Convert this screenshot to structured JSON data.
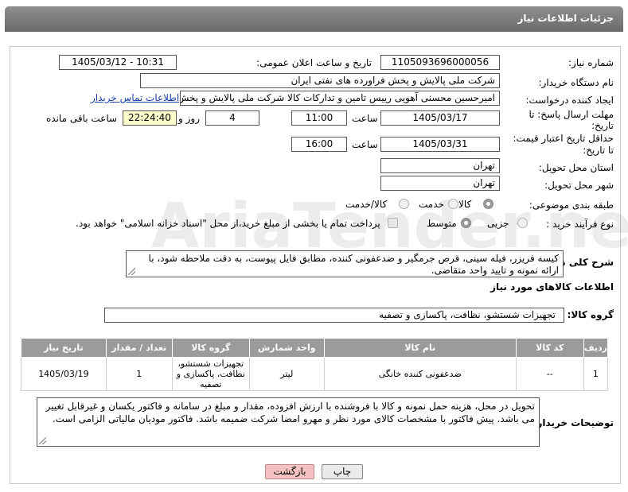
{
  "window": {
    "title": "جزئیات اطلاعات نیاز"
  },
  "watermark": "AriaTender.net",
  "form": {
    "need_number": {
      "label": "شماره نیاز:",
      "value": "1105093696000056"
    },
    "announce_datetime": {
      "label": "تاریخ و ساعت اعلان عمومی:",
      "value": "1405/03/12 - 10:31"
    },
    "buyer_org": {
      "label": "نام دستگاه خریدار:",
      "value": "شرکت ملی پالایش و پخش فراورده های نفتی ایران"
    },
    "requester": {
      "label": "ایجاد کننده درخواست:",
      "value": "امیرحسین محسنی آهویی رییس تامین و تدارکات کالا شرکت ملی پالایش و پخش",
      "contact_link": "اطلاعات تماس خریدار"
    },
    "reply_deadline": {
      "label_line1": "مهلت ارسال پاسخ: تا",
      "label_line2": "تاریخ:",
      "date": "1405/03/17",
      "time_label": "ساعت",
      "time": "11:00",
      "days": "4",
      "days_label": "روز و",
      "remaining": "22:24:40",
      "remaining_label": "ساعت باقی مانده"
    },
    "price_validity": {
      "label_line1": "حداقل تاریخ اعتبار قیمت:",
      "label_line2": "تا تاریخ:",
      "date": "1405/03/31",
      "time_label": "ساعت",
      "time": "16:00"
    },
    "province": {
      "label": "استان محل تحویل:",
      "value": "تهران"
    },
    "city": {
      "label": "شهر محل تحویل:",
      "value": "تهران"
    },
    "category": {
      "label": "طبقه بندی موضوعی:",
      "options": [
        "کالا",
        "خدمت",
        "کالا/خدمت"
      ],
      "selected": "کالا"
    },
    "purchase_process": {
      "label": "نوع فرآیند خرید :",
      "options": [
        "جزیی",
        "متوسط"
      ],
      "selected": "متوسط",
      "payment_note": "پرداخت تمام یا بخشی از مبلغ خرید،از محل \"اسناد خزانه اسلامی\" خواهد بود."
    },
    "general_desc": {
      "label": "شرح کلی نیاز:",
      "value": "کیسه فریزر، فیله سینی، قرص جرمگیر و ضدعفونی کننده، مطابق فایل پیوست، به دقت ملاحظه شود، با ارائه نمونه و تایید واحد متقاضی."
    }
  },
  "goods": {
    "heading": "اطلاعات کالاهای مورد نیاز",
    "group_label": "گروه کالا:",
    "group_value": "تجهیزات شستشو، نظافت، پاکسازی و تصفیه",
    "columns": [
      "ردیف",
      "کد کالا",
      "نام کالا",
      "واحد شمارش",
      "گروه کالا",
      "تعداد / مقدار",
      "تاریخ نیاز"
    ],
    "rows": [
      {
        "row": "1",
        "code": "--",
        "name": "ضدعفونی کننده خانگی",
        "unit": "لیتر",
        "group": "تجهیزات شستشو، نظافت، پاکسازی و تصفیه",
        "qty": "1",
        "date": "1405/03/19"
      }
    ]
  },
  "buyer_notes": {
    "label": "توضیحات خریدار:",
    "value": "تحویل در محل، هزینه حمل نمونه و کالا با فروشنده با ارزش افزوده، مقدار و مبلغ در سامانه و فاکتور یکسان و غیرقابل تغییر می باشد. پیش فاکتور با مشخصات کالای مورد نظر و مهرو امضا شرکت ضمیمه باشد. فاکتور مودیان مالیاتی الزامی است."
  },
  "buttons": {
    "print": "چاپ",
    "back": "بازگشت"
  }
}
